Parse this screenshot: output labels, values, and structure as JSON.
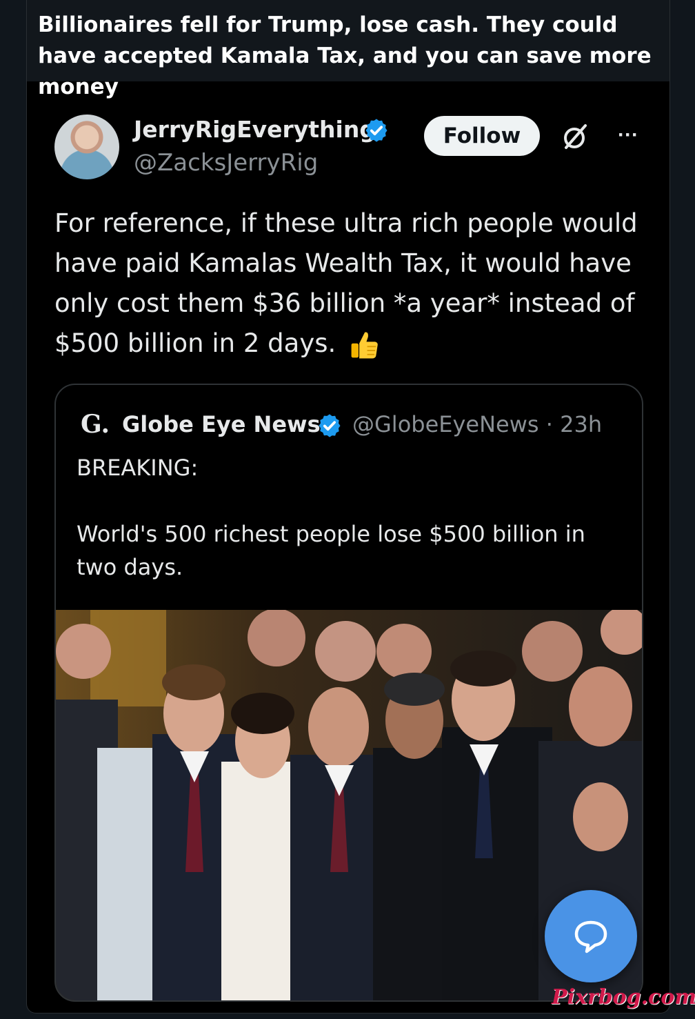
{
  "post": {
    "title": "Billionaires fell for Trump, lose cash. They could have accepted Kamala Tax, and you can save more money"
  },
  "tweet": {
    "author_name": "JerryRigEverything",
    "author_handle": "@ZacksJerryRig",
    "follow_label": "Follow",
    "text": "For reference, if these ultra rich people would have paid Kamalas Wealth Tax, it would have only cost them $36 billion *a year* instead of $500 billion in 2 days.",
    "emoji": "thumbs-up"
  },
  "quote": {
    "logo": "G.",
    "name": "Globe Eye News",
    "handle_time": "@GlobeEyeNews · 23h",
    "text": "BREAKING:\n\nWorld's 500 richest people lose $500 billion in two days."
  },
  "icons": {
    "verified": "verified-badge-icon",
    "grok": "grok-icon",
    "more": "more-options-icon",
    "compose": "reply-bubble-icon"
  },
  "colors": {
    "verified_blue": "#1d9bf0",
    "fab_blue": "#4a93e6",
    "watermark": "#d11a4b"
  },
  "watermark": "Pixrbog.com"
}
